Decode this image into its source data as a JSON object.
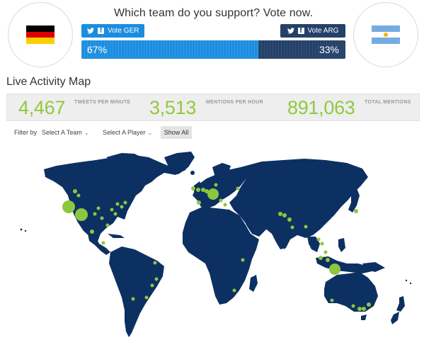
{
  "vote": {
    "title": "Which team do you support? Vote now.",
    "ger_button": "Vote GER",
    "arg_button": "Vote ARG",
    "ger_percent_label": "67%",
    "arg_percent_label": "33%",
    "ger_share": 0.67,
    "arg_share": 0.33,
    "ger_color": "#1b8de0",
    "arg_color": "#25416a"
  },
  "activity": {
    "title": "Live Activity Map",
    "stats": [
      {
        "value": "4,467",
        "label": "TWEETS PER MINUTE"
      },
      {
        "value": "3,513",
        "label": "MENTIONS PER HOUR"
      },
      {
        "value": "891,063",
        "label": "TOTAL MENTIONS"
      }
    ],
    "accent_color": "#92c83e",
    "filter_label": "Filter by",
    "team_select": "Select A Team",
    "player_select": "Select A Player",
    "show_all": "Show All"
  },
  "map": {
    "land_color": "#0d3063",
    "dot_color": "#8dc63f"
  },
  "icons": {
    "twitter": "twitter-icon",
    "facebook": "facebook-icon",
    "chevron": "chevron-down-icon"
  }
}
